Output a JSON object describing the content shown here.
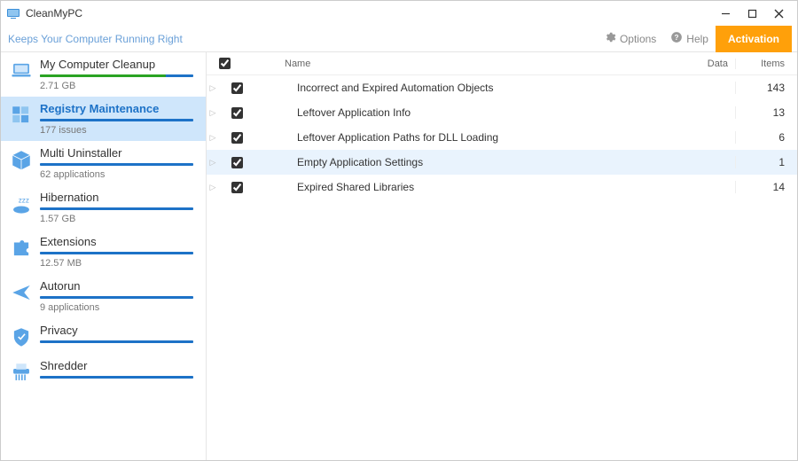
{
  "app": {
    "title": "CleanMyPC",
    "tagline": "Keeps Your Computer Running Right"
  },
  "header": {
    "options": "Options",
    "help": "Help",
    "activation": "Activation"
  },
  "sidebar": [
    {
      "title": "My Computer Cleanup",
      "sub": "2.71 GB",
      "icon": "laptop",
      "bar": "green",
      "active": false
    },
    {
      "title": "Registry Maintenance",
      "sub": "177 issues",
      "icon": "cubes",
      "bar": "blue",
      "active": true
    },
    {
      "title": "Multi Uninstaller",
      "sub": "62 applications",
      "icon": "box",
      "bar": "blue",
      "active": false
    },
    {
      "title": "Hibernation",
      "sub": "1.57 GB",
      "icon": "sleep",
      "bar": "blue",
      "active": false
    },
    {
      "title": "Extensions",
      "sub": "12.57 MB",
      "icon": "puzzle",
      "bar": "blue",
      "active": false
    },
    {
      "title": "Autorun",
      "sub": "9 applications",
      "icon": "plane",
      "bar": "blue",
      "active": false
    },
    {
      "title": "Privacy",
      "sub": "",
      "icon": "shield",
      "bar": "blue",
      "active": false
    },
    {
      "title": "Shredder",
      "sub": "",
      "icon": "shredder",
      "bar": "blue",
      "active": false
    }
  ],
  "list": {
    "columns": {
      "name": "Name",
      "data": "Data",
      "items": "Items"
    },
    "rows": [
      {
        "name": "Incorrect and Expired Automation Objects",
        "data": "",
        "items": "143",
        "hover": false
      },
      {
        "name": "Leftover Application Info",
        "data": "",
        "items": "13",
        "hover": false
      },
      {
        "name": "Leftover Application Paths for DLL Loading",
        "data": "",
        "items": "6",
        "hover": false
      },
      {
        "name": "Empty Application Settings",
        "data": "",
        "items": "1",
        "hover": true
      },
      {
        "name": "Expired Shared Libraries",
        "data": "",
        "items": "14",
        "hover": false
      }
    ]
  }
}
